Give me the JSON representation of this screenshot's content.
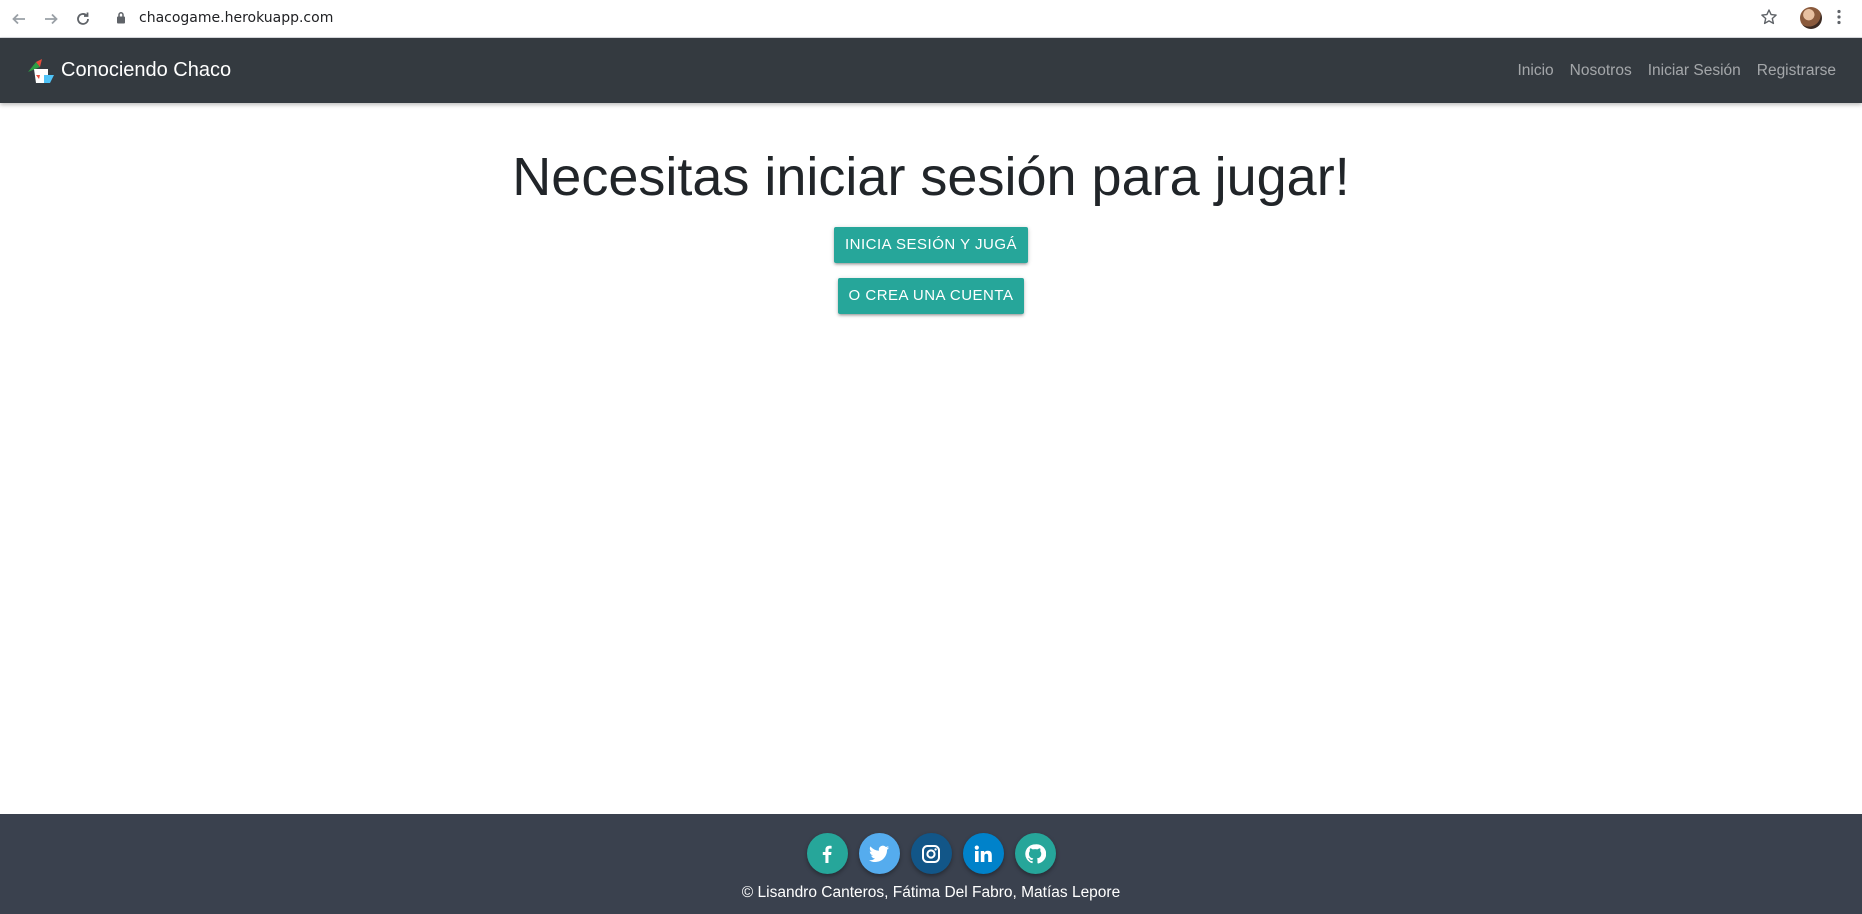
{
  "browser": {
    "url": "chacogame.herokuapp.com"
  },
  "navbar": {
    "brand": "Conociendo Chaco",
    "links": [
      "Inicio",
      "Nosotros",
      "Iniciar Sesión",
      "Registrarse"
    ]
  },
  "main": {
    "heading": "Necesitas iniciar sesión para jugar!",
    "login_button": "INICIA SESIÓN Y JUGÁ",
    "signup_button": "O CREA UNA CUENTA"
  },
  "footer": {
    "socials": [
      {
        "icon": "facebook-icon",
        "color": "#26a69a"
      },
      {
        "icon": "twitter-icon",
        "color": "#55acee"
      },
      {
        "icon": "instagram-icon",
        "color": "#125688"
      },
      {
        "icon": "linkedin-icon",
        "color": "#0082ca"
      },
      {
        "icon": "github-icon",
        "color": "#26a69a"
      }
    ],
    "copyright": "© Lisandro Canteros, Fátima Del Fabro, Matías Lepore"
  },
  "colors": {
    "navbar_bg": "#343a40",
    "footer_bg": "#3a414e",
    "accent": "#26a69a"
  }
}
